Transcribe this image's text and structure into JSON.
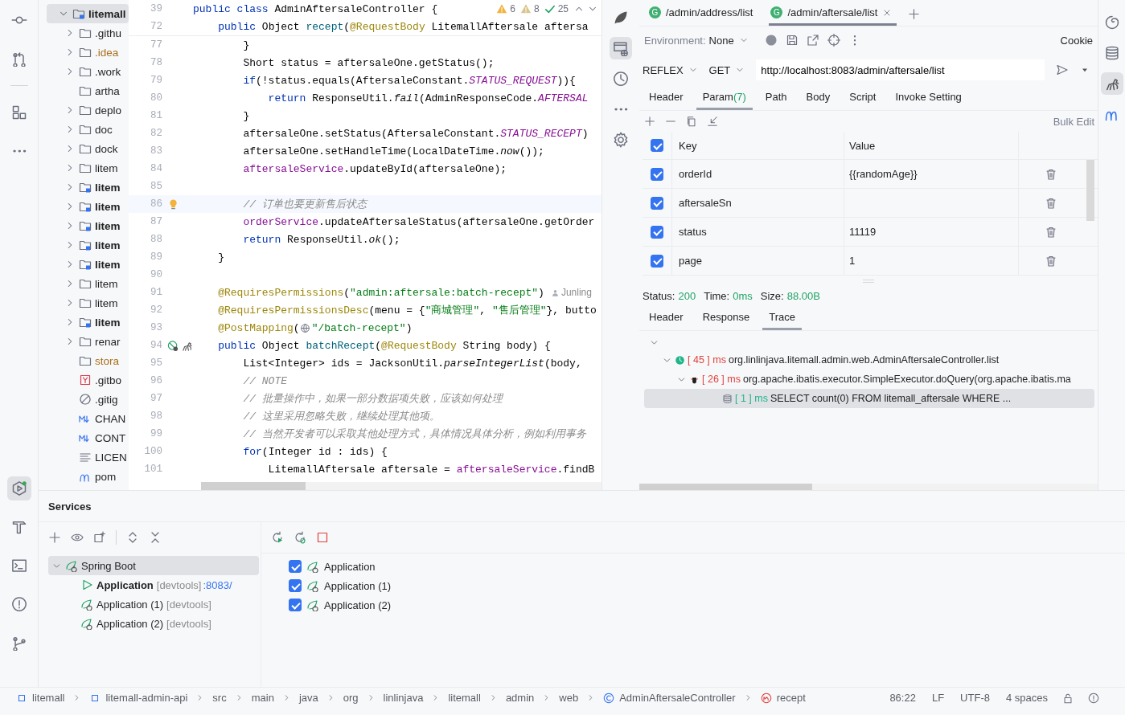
{
  "project_tree": {
    "label": "litemall",
    "kind": "module",
    "expanded": true,
    "color": "#1f1f1f",
    "children": [
      {
        "label": ".githu",
        "kind": "folder",
        "expanded": false,
        "color": "#1f1f1f"
      },
      {
        "label": ".idea",
        "kind": "folder",
        "expanded": false,
        "color": "#a8701a"
      },
      {
        "label": ".work",
        "kind": "folder",
        "expanded": false,
        "color": "#1f1f1f"
      },
      {
        "label": "artha",
        "kind": "folder",
        "color": "#1f1f1f"
      },
      {
        "label": "deplo",
        "kind": "folder",
        "expanded": false,
        "color": "#1f1f1f"
      },
      {
        "label": "doc",
        "kind": "folder",
        "expanded": false,
        "color": "#1f1f1f"
      },
      {
        "label": "dock",
        "kind": "folder",
        "expanded": false,
        "color": "#1f1f1f"
      },
      {
        "label": "litem",
        "kind": "folder",
        "expanded": false,
        "color": "#1f1f1f"
      },
      {
        "label": "litem",
        "kind": "module",
        "expanded": false,
        "color": "#1f1f1f"
      },
      {
        "label": "litem",
        "kind": "module",
        "expanded": false,
        "color": "#1f1f1f"
      },
      {
        "label": "litem",
        "kind": "module",
        "expanded": false,
        "color": "#1f1f1f"
      },
      {
        "label": "litem",
        "kind": "module",
        "expanded": false,
        "color": "#1f1f1f"
      },
      {
        "label": "litem",
        "kind": "module",
        "expanded": false,
        "color": "#1f1f1f"
      },
      {
        "label": "litem",
        "kind": "folder",
        "expanded": false,
        "color": "#1f1f1f"
      },
      {
        "label": "litem",
        "kind": "folder",
        "expanded": false,
        "color": "#1f1f1f"
      },
      {
        "label": "litem",
        "kind": "module",
        "expanded": false,
        "color": "#1f1f1f"
      },
      {
        "label": "renar",
        "kind": "folder",
        "expanded": false,
        "color": "#1f1f1f"
      },
      {
        "label": "stora",
        "kind": "folder",
        "color": "#a8701a"
      },
      {
        "label": ".gitbo",
        "kind": "yaml",
        "color": "#1f1f1f"
      },
      {
        "label": ".gitig",
        "kind": "ignore",
        "color": "#1f1f1f"
      },
      {
        "label": "CHAN",
        "kind": "markdown",
        "color": "#1f1f1f"
      },
      {
        "label": "CONT",
        "kind": "markdown",
        "color": "#1f1f1f"
      },
      {
        "label": "LICEN",
        "kind": "text",
        "color": "#1f1f1f"
      },
      {
        "label": "pom",
        "kind": "maven",
        "color": "#1f1f1f"
      }
    ]
  },
  "editor": {
    "inspections": {
      "warnings": "6",
      "weak_warnings": "8",
      "ok": "25"
    },
    "lines": [
      {
        "number": "39",
        "sticky": true,
        "tokens": [
          {
            "kind": "kw",
            "text": "public class "
          },
          {
            "kind": "plain",
            "text": "AdminAftersaleController {"
          }
        ]
      },
      {
        "number": "72",
        "sticky": true,
        "tokens": [
          {
            "kind": "kw",
            "text": "    public "
          },
          {
            "kind": "plain",
            "text": "Object "
          },
          {
            "kind": "decl",
            "text": "recept"
          },
          {
            "kind": "plain",
            "text": "("
          },
          {
            "kind": "ann",
            "text": "@RequestBody"
          },
          {
            "kind": "plain",
            "text": " LitemallAftersale aftersa"
          }
        ]
      },
      {
        "number": "77",
        "tokens": [
          {
            "kind": "plain",
            "text": "        }"
          }
        ]
      },
      {
        "number": "78",
        "tokens": [
          {
            "kind": "plain",
            "text": "        Short status = aftersaleOne.getStatus();"
          }
        ]
      },
      {
        "number": "79",
        "tokens": [
          {
            "kind": "kw",
            "text": "        if"
          },
          {
            "kind": "plain",
            "text": "(!status.equals(AftersaleConstant."
          },
          {
            "kind": "const",
            "text": "STATUS_REQUEST"
          },
          {
            "kind": "plain",
            "text": ")){"
          }
        ]
      },
      {
        "number": "80",
        "tokens": [
          {
            "kind": "kw",
            "text": "            return "
          },
          {
            "kind": "plain",
            "text": "ResponseUtil."
          },
          {
            "kind": "static",
            "text": "fail"
          },
          {
            "kind": "plain",
            "text": "(AdminResponseCode."
          },
          {
            "kind": "const",
            "text": "AFTERSAL"
          }
        ]
      },
      {
        "number": "81",
        "tokens": [
          {
            "kind": "plain",
            "text": "        }"
          }
        ]
      },
      {
        "number": "82",
        "tokens": [
          {
            "kind": "plain",
            "text": "        aftersaleOne.setStatus(AftersaleConstant."
          },
          {
            "kind": "const",
            "text": "STATUS_RECEPT"
          },
          {
            "kind": "plain",
            "text": ")"
          }
        ]
      },
      {
        "number": "83",
        "tokens": [
          {
            "kind": "plain",
            "text": "        aftersaleOne.setHandleTime(LocalDateTime."
          },
          {
            "kind": "static",
            "text": "now"
          },
          {
            "kind": "plain",
            "text": "());"
          }
        ]
      },
      {
        "number": "84",
        "tokens": [
          {
            "kind": "field",
            "text": "        aftersaleService"
          },
          {
            "kind": "plain",
            "text": ".updateById(aftersaleOne);"
          }
        ]
      },
      {
        "number": "85"
      },
      {
        "number": "86",
        "current": true,
        "tokens": [
          {
            "kind": "comment",
            "text": "        // 订单也要更新售后状态"
          }
        ]
      },
      {
        "number": "87",
        "tokens": [
          {
            "kind": "field",
            "text": "        orderService"
          },
          {
            "kind": "plain",
            "text": ".updateAftersaleStatus(aftersaleOne.getOrder"
          }
        ]
      },
      {
        "number": "88",
        "tokens": [
          {
            "kind": "kw",
            "text": "        return "
          },
          {
            "kind": "plain",
            "text": "ResponseUtil."
          },
          {
            "kind": "static",
            "text": "ok"
          },
          {
            "kind": "plain",
            "text": "();"
          }
        ]
      },
      {
        "number": "89",
        "tokens": [
          {
            "kind": "plain",
            "text": "    }"
          }
        ]
      },
      {
        "number": "90"
      },
      {
        "number": "91",
        "author": "Junling",
        "tokens": [
          {
            "kind": "ann",
            "text": "    @RequiresPermissions"
          },
          {
            "kind": "plain",
            "text": "("
          },
          {
            "kind": "str",
            "text": "\"admin:aftersale:batch-recept\""
          },
          {
            "kind": "plain",
            "text": ")"
          }
        ]
      },
      {
        "number": "92",
        "tokens": [
          {
            "kind": "ann",
            "text": "    @RequiresPermissionsDesc"
          },
          {
            "kind": "plain",
            "text": "(menu = {"
          },
          {
            "kind": "str",
            "text": "\"商城管理\""
          },
          {
            "kind": "plain",
            "text": ", "
          },
          {
            "kind": "str",
            "text": "\"售后管理\""
          },
          {
            "kind": "plain",
            "text": "}, butto"
          }
        ]
      },
      {
        "number": "93",
        "tokens": [
          {
            "kind": "ann",
            "text": "    @PostMapping"
          },
          {
            "kind": "plain",
            "text": "("
          },
          {
            "kind": "globe"
          },
          {
            "kind": "str",
            "text": "\"/batch-recept\""
          },
          {
            "kind": "plain",
            "text": ")"
          }
        ]
      },
      {
        "number": "94",
        "endpoint": true,
        "tokens": [
          {
            "kind": "kw",
            "text": "    public "
          },
          {
            "kind": "plain",
            "text": "Object "
          },
          {
            "kind": "decl",
            "text": "batchRecept"
          },
          {
            "kind": "plain",
            "text": "("
          },
          {
            "kind": "ann",
            "text": "@RequestBody"
          },
          {
            "kind": "plain",
            "text": " String body) {"
          }
        ]
      },
      {
        "number": "95",
        "tokens": [
          {
            "kind": "plain",
            "text": "        List<Integer> ids = JacksonUtil."
          },
          {
            "kind": "static",
            "text": "parseIntegerList"
          },
          {
            "kind": "plain",
            "text": "(body,"
          }
        ]
      },
      {
        "number": "96",
        "tokens": [
          {
            "kind": "comment",
            "text": "        // NOTE"
          }
        ]
      },
      {
        "number": "97",
        "tokens": [
          {
            "kind": "comment",
            "text": "        // 批量操作中，如果一部分数据项失败，应该如何处理"
          }
        ]
      },
      {
        "number": "98",
        "tokens": [
          {
            "kind": "comment",
            "text": "        // 这里采用忽略失败，继续处理其他项。"
          }
        ]
      },
      {
        "number": "99",
        "tokens": [
          {
            "kind": "comment",
            "text": "        // 当然开发者可以采取其他处理方式，具体情况具体分析，例如利用事务"
          }
        ]
      },
      {
        "number": "100",
        "tokens": [
          {
            "kind": "kw",
            "text": "        for"
          },
          {
            "kind": "plain",
            "text": "(Integer id : ids) {"
          }
        ]
      },
      {
        "number": "101",
        "tokens": [
          {
            "kind": "plain",
            "text": "            LitemallAftersale aftersale = "
          },
          {
            "kind": "field",
            "text": "aftersaleService"
          },
          {
            "kind": "plain",
            "text": ".findB"
          }
        ]
      }
    ]
  },
  "api_client": {
    "tabs": [
      {
        "badge": "G",
        "label": "/admin/address/list",
        "selected": false
      },
      {
        "badge": "G",
        "label": "/admin/aftersale/list",
        "selected": true
      }
    ],
    "environment": {
      "label": "Environment:",
      "value": "None"
    },
    "cookie": "Cookie",
    "project": "REFLEX",
    "method": "GET",
    "url": "http://localhost:8083/admin/aftersale/list",
    "request_tabs": [
      {
        "label": "Header",
        "selected": false
      },
      {
        "label": "Param",
        "count": "(7)",
        "selected": true
      },
      {
        "label": "Path",
        "selected": false
      },
      {
        "label": "Body",
        "selected": false
      },
      {
        "label": "Script",
        "selected": false
      },
      {
        "label": "Invoke Setting",
        "selected": false
      }
    ],
    "bulk_edit": "Bulk Edit",
    "params": {
      "all_checked": true,
      "columns": [
        "Key",
        "Value"
      ],
      "rows": [
        {
          "key": "orderId",
          "value": "{{randomAge}}",
          "checked": true
        },
        {
          "key": "aftersaleSn",
          "checked": true
        },
        {
          "key": "status",
          "value": "11119",
          "checked": true
        },
        {
          "key": "page",
          "value": "1",
          "checked": true
        }
      ]
    },
    "status": [
      {
        "label": "Status:",
        "value": "200"
      },
      {
        "label": "Time:",
        "value": "0ms"
      },
      {
        "label": "Size:",
        "value": "88.00B"
      }
    ],
    "response_tabs": [
      {
        "label": "Header",
        "selected": false
      },
      {
        "label": "Response",
        "selected": false
      },
      {
        "label": "Trace",
        "selected": true
      }
    ],
    "trace": [
      {
        "time": "[ 45 ] ms",
        "color": "#e0443e",
        "text": "org.linlinjava.litemall.admin.web.AdminAftersaleController.list",
        "kind": "controller",
        "expanded": true,
        "selected": false,
        "children": [
          {
            "time": "[ 26 ] ms",
            "color": "#e0443e",
            "text": "org.apache.ibatis.executor.SimpleExecutor.doQuery(org.apache.ibatis.ma",
            "kind": "executor",
            "expanded": true,
            "selected": false,
            "children": [
              {
                "time": "[ 1 ] ms",
                "color": "#21b58a",
                "text": "SELECT   count(0) FROM   litemall_aftersale WHERE ...",
                "kind": "sql",
                "selected": true
              }
            ]
          }
        ]
      }
    ]
  },
  "services": {
    "title": "Services",
    "tree": {
      "label": "Spring Boot",
      "expanded": true,
      "selected": true,
      "children": [
        {
          "label": "Application",
          "tag": "[devtools]",
          "port": ":8083/",
          "running": true
        },
        {
          "label": "Application (1)",
          "tag": "[devtools]",
          "running": false
        },
        {
          "label": "Application (2)",
          "tag": "[devtools]",
          "running": false
        }
      ]
    },
    "targets": [
      {
        "label": "Application",
        "checked": true
      },
      {
        "label": "Application (1)",
        "checked": true
      },
      {
        "label": "Application (2)",
        "checked": true
      }
    ]
  },
  "breadcrumbs": [
    {
      "label": "litemall",
      "kind": "module"
    },
    {
      "label": "litemall-admin-api",
      "kind": "module"
    },
    {
      "label": "src"
    },
    {
      "label": "main"
    },
    {
      "label": "java"
    },
    {
      "label": "org"
    },
    {
      "label": "linlinjava"
    },
    {
      "label": "litemall"
    },
    {
      "label": "admin"
    },
    {
      "label": "web"
    },
    {
      "label": "AdminAftersaleController",
      "kind": "class"
    },
    {
      "label": "recept",
      "kind": "method"
    }
  ],
  "status_bar": {
    "position": "86:22",
    "line_ending": "LF",
    "encoding": "UTF-8",
    "indent": "4 spaces"
  }
}
